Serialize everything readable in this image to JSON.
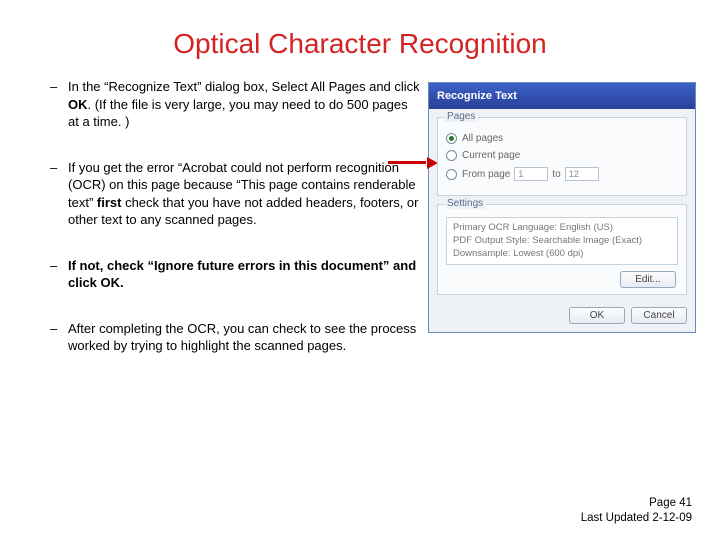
{
  "title": "Optical Character Recognition",
  "bullets": {
    "b1_a": "In the “Recognize Text” dialog box, Select All Pages and click ",
    "b1_ok": "OK",
    "b1_b": ". (If the file is very large, you may need to do 500 pages at a time. )",
    "b2_a": "If you get the error “Acrobat could not perform recognition (OCR) on this page because “This page contains renderable text” ",
    "b2_first": "first",
    "b2_b": " check that you have not added headers, footers, or other text to any scanned pages.",
    "b3": "If not, check “Ignore future errors in this document” and click OK.",
    "b4": "After completing the OCR, you can check to see the process worked by trying to highlight the scanned pages."
  },
  "dialog": {
    "title": "Recognize Text",
    "pages_legend": "Pages",
    "opt_all": "All pages",
    "opt_current": "Current page",
    "opt_from": "From page",
    "to_label": "to",
    "from_val": "1",
    "to_val": "12",
    "settings_legend": "Settings",
    "settings_lines": {
      "l1": "Primary OCR Language: English (US)",
      "l2": "PDF Output Style: Searchable Image (Exact)",
      "l3": "Downsample: Lowest (600 dpi)"
    },
    "edit_btn": "Edit...",
    "ok_btn": "OK",
    "cancel_btn": "Cancel"
  },
  "footer": {
    "page": "Page 41",
    "updated": "Last Updated 2-12-09"
  }
}
